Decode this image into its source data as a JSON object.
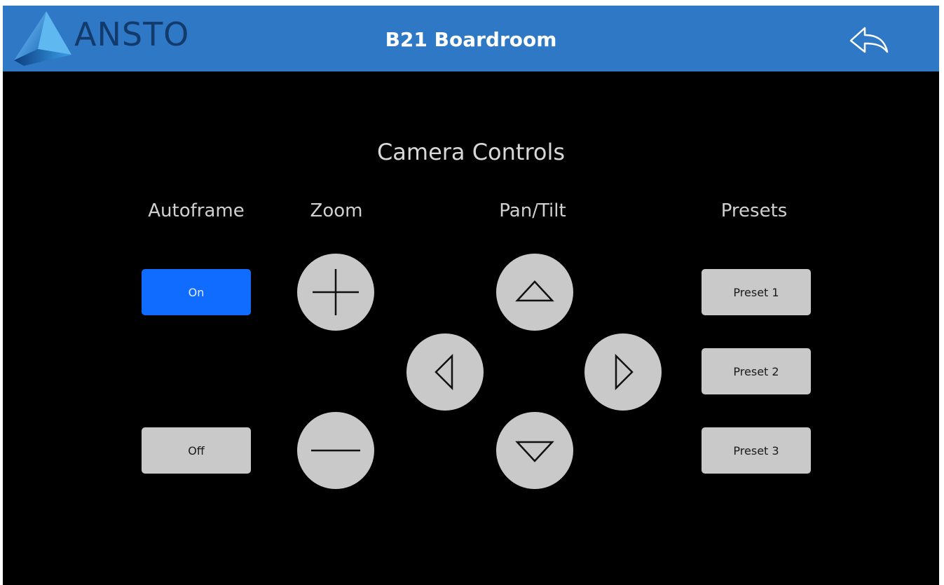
{
  "header": {
    "logo_text": "ANSTO",
    "room_title": "B21 Boardroom",
    "back_icon": "reply-arrow-icon"
  },
  "main": {
    "section_title": "Camera Controls",
    "autoframe": {
      "label": "Autoframe",
      "on_label": "On",
      "off_label": "Off",
      "selected": "On"
    },
    "zoom": {
      "label": "Zoom",
      "in_icon": "plus-icon",
      "out_icon": "minus-icon"
    },
    "pan_tilt": {
      "label": "Pan/Tilt",
      "up_icon": "triangle-up-icon",
      "down_icon": "triangle-down-icon",
      "left_icon": "triangle-left-icon",
      "right_icon": "triangle-right-icon"
    },
    "presets": {
      "label": "Presets",
      "items": [
        "Preset 1",
        "Preset 2",
        "Preset 3"
      ]
    }
  },
  "colors": {
    "header_bg": "#2F78C5",
    "active_button": "#0F6CFF",
    "button_gray": "#C9C9C9",
    "background": "#000000"
  }
}
